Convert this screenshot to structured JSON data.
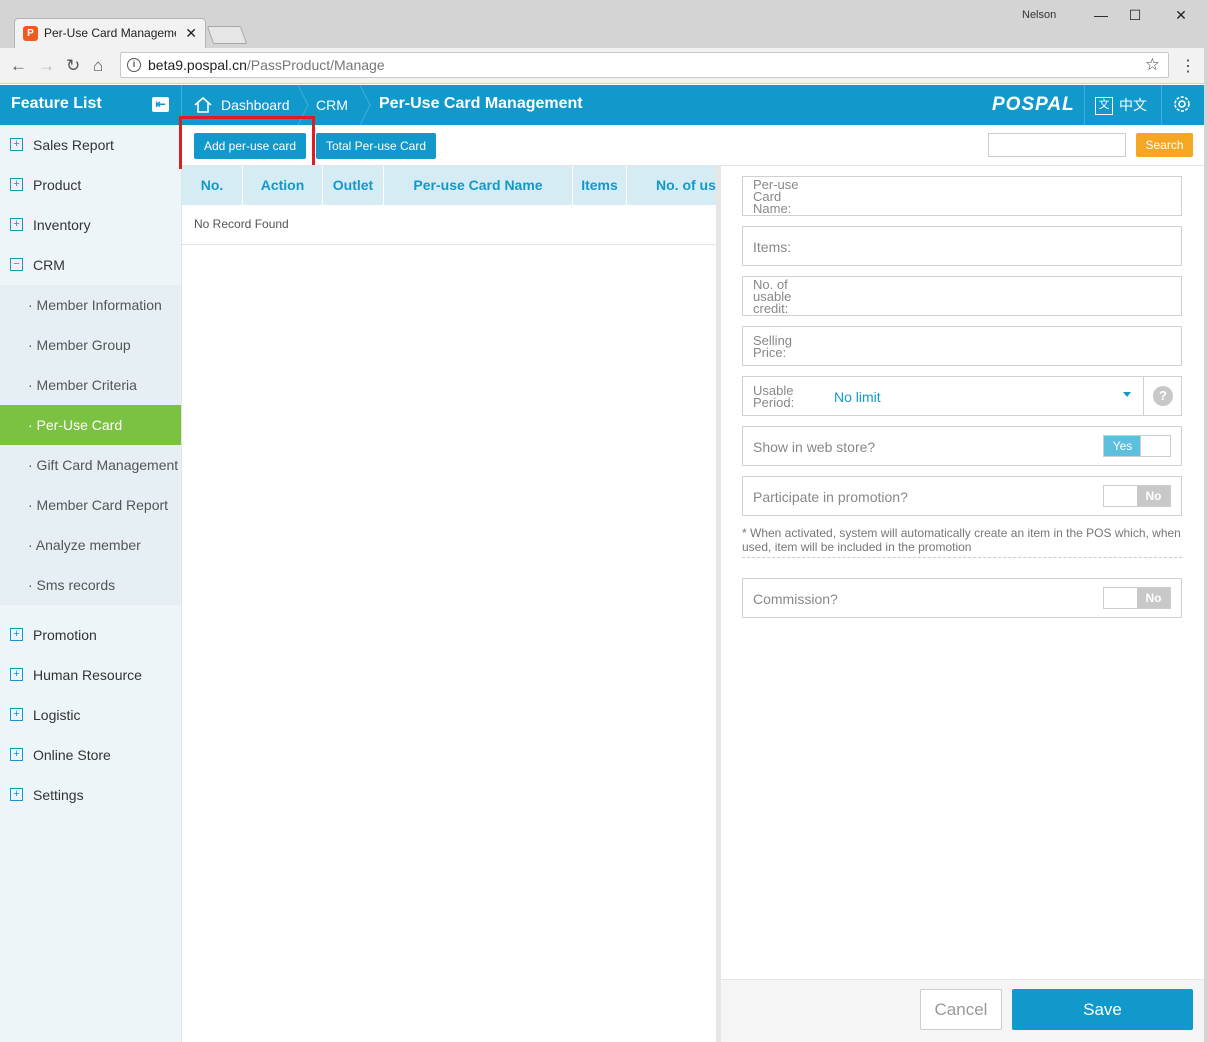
{
  "browser": {
    "tab_title": "Per-Use Card Manageme",
    "user": "Nelson",
    "url_host": "beta9.pospal.cn",
    "url_path": "/PassProduct/Manage"
  },
  "header": {
    "feature_list": "Feature List",
    "breadcrumb_dashboard": "Dashboard",
    "breadcrumb_crm": "CRM",
    "breadcrumb_current": "Per-Use Card Management",
    "logo": "POSPAL",
    "language": "中文"
  },
  "sidebar": {
    "items": [
      {
        "label": "Sales Report",
        "icon": "plus"
      },
      {
        "label": "Product",
        "icon": "plus"
      },
      {
        "label": "Inventory",
        "icon": "plus"
      },
      {
        "label": "CRM",
        "icon": "minus"
      }
    ],
    "crm_sub": [
      {
        "label": "· Member Information"
      },
      {
        "label": "· Member Group"
      },
      {
        "label": "· Member Criteria"
      },
      {
        "label": "· Per-Use Card"
      },
      {
        "label": "· Gift Card Management"
      },
      {
        "label": "· Member Card Report"
      },
      {
        "label": "· Analyze member"
      },
      {
        "label": "· Sms records"
      }
    ],
    "items_after": [
      {
        "label": "Promotion"
      },
      {
        "label": "Human Resource"
      },
      {
        "label": "Logistic"
      },
      {
        "label": "Online Store"
      },
      {
        "label": "Settings"
      }
    ]
  },
  "toolbar": {
    "add_button": "Add per-use card",
    "total_button": "Total Per-use Card",
    "search_button": "Search",
    "search_value": ""
  },
  "table": {
    "columns": [
      "No.",
      "Action",
      "Outlet",
      "Per-use Card Name",
      "Items",
      "No. of usa"
    ],
    "empty_text": "No Record Found"
  },
  "form": {
    "card_name_label": "Per-use\nCard\nName:",
    "items_label": "Items:",
    "credit_label": "No. of\nusable\ncredit:",
    "price_label": "Selling\nPrice:",
    "period_label": "Usable\nPeriod:",
    "period_value": "No limit",
    "help_icon_text": "?",
    "web_store_label": "Show in web store?",
    "web_store_value": "Yes",
    "promotion_label": "Participate in promotion?",
    "promotion_value": "No",
    "promotion_note": "* When activated, system will automatically create an item in the POS which, when used, item will be included in the promotion",
    "commission_label": "Commission?",
    "commission_value": "No",
    "cancel_button": "Cancel",
    "save_button": "Save"
  },
  "colors": {
    "primary": "#1199cc",
    "active_menu": "#7cc242",
    "search_button": "#f5a623",
    "highlight": "#e01b24"
  }
}
